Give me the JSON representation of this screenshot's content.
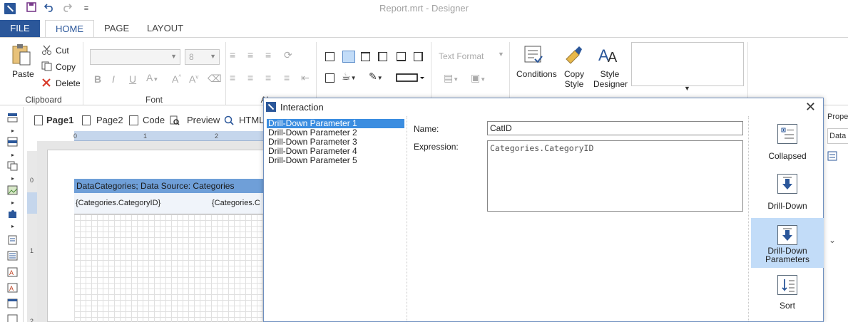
{
  "window": {
    "title": "Report.mrt - Designer"
  },
  "ribbon_tabs": [
    "FILE",
    "HOME",
    "PAGE",
    "LAYOUT"
  ],
  "clipboard": {
    "paste": "Paste",
    "cut": "Cut",
    "copy": "Copy",
    "delete": "Delete",
    "group_label": "Clipboard"
  },
  "font": {
    "family_value": "",
    "size_value": "8",
    "group_label": "Font"
  },
  "alignment": {
    "group_label": "Al"
  },
  "text_format": {
    "combo_value": "Text Format"
  },
  "styles": {
    "conditions": "Conditions",
    "copy_style_line1": "Copy",
    "copy_style_line2": "Style",
    "style_designer_line1": "Style",
    "style_designer_line2": "Designer"
  },
  "page_tabs": {
    "page1": "Page1",
    "page2": "Page2",
    "code": "Code",
    "preview": "Preview",
    "html": "HTML"
  },
  "ruler": {
    "top_marks": [
      "0",
      "1",
      "2"
    ],
    "left_marks": [
      "0",
      "1",
      "2"
    ]
  },
  "designer": {
    "band_title": "DataCategories; Data Source: Categories",
    "cell1": "{Categories.CategoryID}",
    "cell2": "{Categories.C"
  },
  "properties": {
    "header": "Prope",
    "combo": "Data"
  },
  "dialog": {
    "title": "Interaction",
    "parameters": [
      "Drill-Down Parameter 1",
      "Drill-Down Parameter 2",
      "Drill-Down Parameter 3",
      "Drill-Down Parameter 4",
      "Drill-Down Parameter 5"
    ],
    "selected_index": 0,
    "name_label": "Name:",
    "name_value": "CatID",
    "expression_label": "Expression:",
    "expression_value": "Categories.CategoryID",
    "side_buttons": {
      "collapsed": "Collapsed",
      "drilldown": "Drill-Down",
      "drilldown_params_line1": "Drill-Down",
      "drilldown_params_line2": "Parameters",
      "sort": "Sort"
    }
  },
  "colors": {
    "accent": "#2b579a",
    "band_header": "#6f9fd8",
    "selection": "#3b8de0",
    "active_side_button": "#c2dcf8"
  }
}
